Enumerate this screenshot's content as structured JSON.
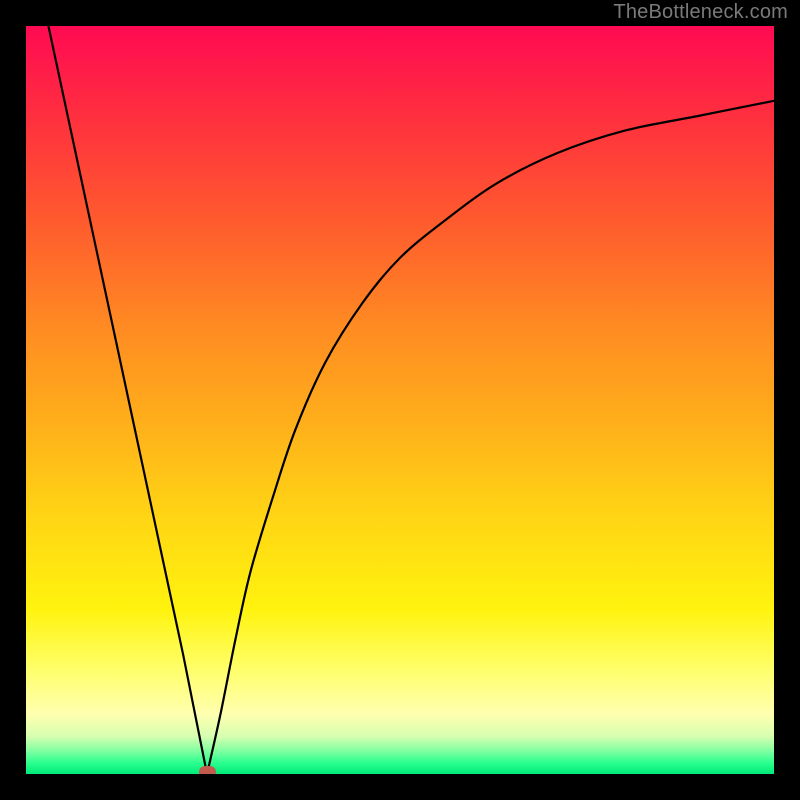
{
  "attribution": "TheBottleneck.com",
  "colors": {
    "bg_frame": "#000000",
    "marker": "#c35a4e",
    "curve": "#000000",
    "gradient_top": "#ff0a52",
    "gradient_mid": "#ffd614",
    "gradient_bottom": "#00e97a"
  },
  "chart_data": {
    "type": "line",
    "title": "",
    "xlabel": "",
    "ylabel": "",
    "xlim": [
      0,
      100
    ],
    "ylim": [
      0,
      100
    ],
    "series": [
      {
        "name": "left-branch",
        "x": [
          3,
          6,
          9,
          12,
          15,
          18,
          21,
          23,
          24.2
        ],
        "values": [
          100,
          86,
          72,
          58,
          44,
          30,
          16,
          6,
          0
        ]
      },
      {
        "name": "right-branch",
        "x": [
          24.2,
          26,
          28,
          30,
          33,
          36,
          40,
          45,
          50,
          56,
          63,
          71,
          80,
          90,
          100
        ],
        "values": [
          0,
          8,
          18,
          27,
          37,
          46,
          55,
          63,
          69,
          74,
          79,
          83,
          86,
          88,
          90
        ]
      }
    ],
    "annotations": [
      {
        "name": "minimum-marker",
        "x": 24.2,
        "y": 0
      }
    ]
  }
}
